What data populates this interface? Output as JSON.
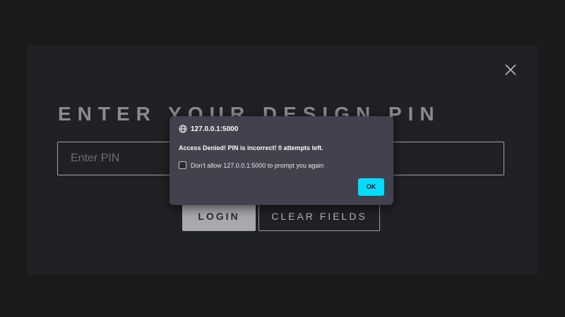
{
  "page": {
    "title": "ENTER YOUR DESIGN PIN",
    "close_icon": "close-icon",
    "pin_input": {
      "value": "",
      "placeholder": "Enter PIN"
    },
    "login_label": "LOGIN",
    "clear_label": "CLEAR FIELDS"
  },
  "dialog": {
    "origin": "127.0.0.1:5000",
    "origin_icon": "globe-icon",
    "message": "Access Denied! PIN is incorrect! 0 attempts left.",
    "checkbox_label": "Don't allow 127.0.0.1:5000 to prompt you again",
    "checkbox_checked": false,
    "ok_label": "OK"
  },
  "colors": {
    "background": "#1b1b1e",
    "panel": "#202124",
    "dialog_bg": "#42414d",
    "ok_accent": "#00ddff"
  }
}
